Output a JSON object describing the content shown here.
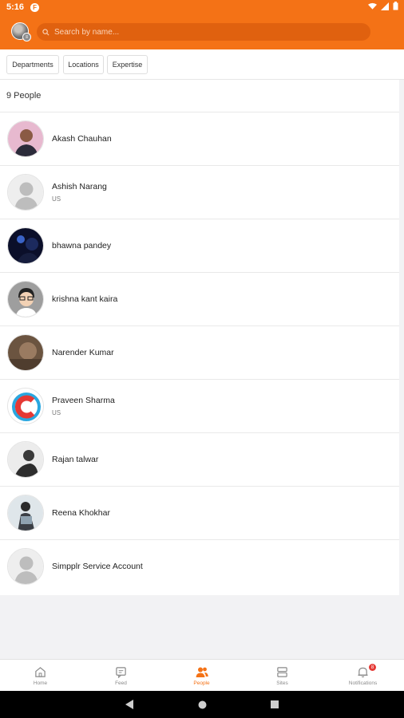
{
  "status_bar": {
    "time": "5:16",
    "app_glyph": "F"
  },
  "search": {
    "placeholder": "Search by name..."
  },
  "filters": [
    "Departments",
    "Locations",
    "Expertise"
  ],
  "people_count": "9 People",
  "people": [
    {
      "name": "Akash Chauhan",
      "location": "",
      "avatar": "photo"
    },
    {
      "name": "Ashish Narang",
      "location": "US",
      "avatar": "default"
    },
    {
      "name": "bhawna pandey",
      "location": "",
      "avatar": "photo"
    },
    {
      "name": "krishna kant kaira",
      "location": "",
      "avatar": "cartoon"
    },
    {
      "name": "Narender Kumar",
      "location": "",
      "avatar": "photo"
    },
    {
      "name": "Praveen Sharma",
      "location": "US",
      "avatar": "logo"
    },
    {
      "name": "Rajan talwar",
      "location": "",
      "avatar": "photo"
    },
    {
      "name": "Reena Khokhar",
      "location": "",
      "avatar": "photo"
    },
    {
      "name": "Simpplr Service Account",
      "location": "",
      "avatar": "default"
    }
  ],
  "bottom_nav": [
    {
      "label": "Home",
      "icon": "home-icon",
      "active": false
    },
    {
      "label": "Feed",
      "icon": "feed-icon",
      "active": false
    },
    {
      "label": "People",
      "icon": "people-icon",
      "active": true
    },
    {
      "label": "Sites",
      "icon": "sites-icon",
      "active": false
    },
    {
      "label": "Notifications",
      "icon": "bell-icon",
      "active": false,
      "badge": "8"
    }
  ],
  "colors": {
    "brand": "#f47216",
    "badge": "#e53935"
  }
}
